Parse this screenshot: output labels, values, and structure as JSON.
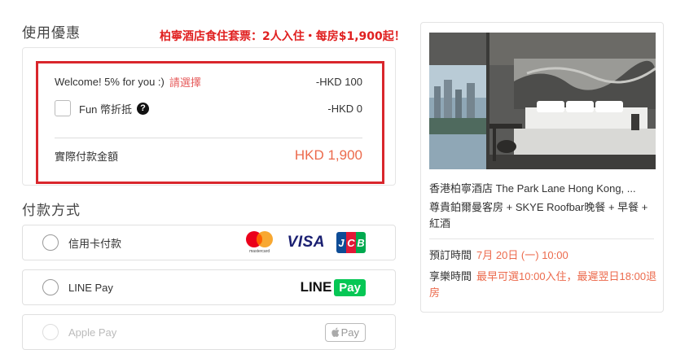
{
  "discount": {
    "title": "使用優惠",
    "promo_banner": "柏寧酒店食住套票：2人入住・每房$1,900起！",
    "welcome_label": "Welcome! 5% for you :)",
    "select_link": "請選擇",
    "welcome_amount": "-HKD 100",
    "fun_coin_label": "Fun 幣折抵",
    "fun_coin_amount": "-HKD 0",
    "total_label": "實際付款金額",
    "total_amount": "HKD 1,900"
  },
  "payment": {
    "title": "付款方式",
    "methods": [
      {
        "label": "信用卡付款"
      },
      {
        "label": "LINE Pay"
      },
      {
        "label": "Apple Pay"
      }
    ],
    "logos": {
      "mastercard_text": "mastercard",
      "visa": "VISA",
      "line": "LINE",
      "line_pay": "Pay",
      "apple_pay": "Pay"
    }
  },
  "summary": {
    "hotel_name": "香港柏寧酒店 The Park Lane Hong Kong, ...",
    "plan_name": "尊貴鉑爾曼客房 + SKYE Roofbar晚餐 + 早餐 + 紅酒",
    "booking_label": "預訂時間",
    "booking_value": "7月 20日 (一) 10:00",
    "enjoy_label": "享樂時間",
    "enjoy_value": "最早可選10:00入住，最遲翌日18:00退房"
  }
}
